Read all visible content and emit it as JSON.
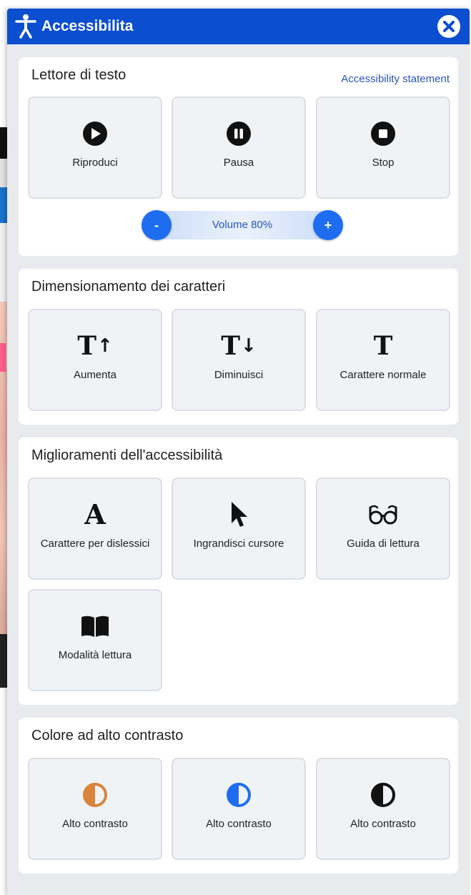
{
  "header": {
    "title": "Accessibilita",
    "logo_icon": "accessibility-person-icon",
    "close_icon": "close-icon"
  },
  "text_reader": {
    "title": "Lettore di testo",
    "statement_link": "Accessibility statement",
    "buttons": [
      {
        "label": "Riproduci",
        "icon": "play-icon"
      },
      {
        "label": "Pausa",
        "icon": "pause-icon"
      },
      {
        "label": "Stop",
        "icon": "stop-icon"
      }
    ],
    "volume": {
      "minus": "-",
      "plus": "+",
      "label": "Volume 80%",
      "value_percent": 80
    }
  },
  "font_sizing": {
    "title": "Dimensionamento dei caratteri",
    "buttons": [
      {
        "label": "Aumenta",
        "icon": "text-increase-icon",
        "glyph": "T",
        "arrow": "↑"
      },
      {
        "label": "Diminuisci",
        "icon": "text-decrease-icon",
        "glyph": "T",
        "arrow": "↓"
      },
      {
        "label": "Carattere normale",
        "icon": "text-normal-icon",
        "glyph": "T"
      }
    ]
  },
  "improvements": {
    "title": "Miglioramenti dell'accessibilità",
    "buttons": [
      {
        "label": "Carattere per dislessici",
        "icon": "dyslexic-font-icon",
        "glyph": "A"
      },
      {
        "label": "Ingrandisci cursore",
        "icon": "cursor-icon"
      },
      {
        "label": "Guida di lettura",
        "icon": "glasses-icon"
      },
      {
        "label": "Modalità lettura",
        "icon": "book-icon"
      }
    ]
  },
  "contrast": {
    "title": "Colore ad alto contrasto",
    "buttons": [
      {
        "label": "Alto contrasto",
        "icon": "contrast-icon",
        "color": "#d9853b"
      },
      {
        "label": "Alto contrasto",
        "icon": "contrast-icon",
        "color": "#1e6df0"
      },
      {
        "label": "Alto contrasto",
        "icon": "contrast-icon",
        "color": "#111111"
      }
    ]
  },
  "colors": {
    "header_bg": "#0b4ecf",
    "accent": "#1e6df0",
    "link": "#2c55b8",
    "panel_bg": "#e9eaed",
    "card_bg": "#f0f3f6"
  }
}
